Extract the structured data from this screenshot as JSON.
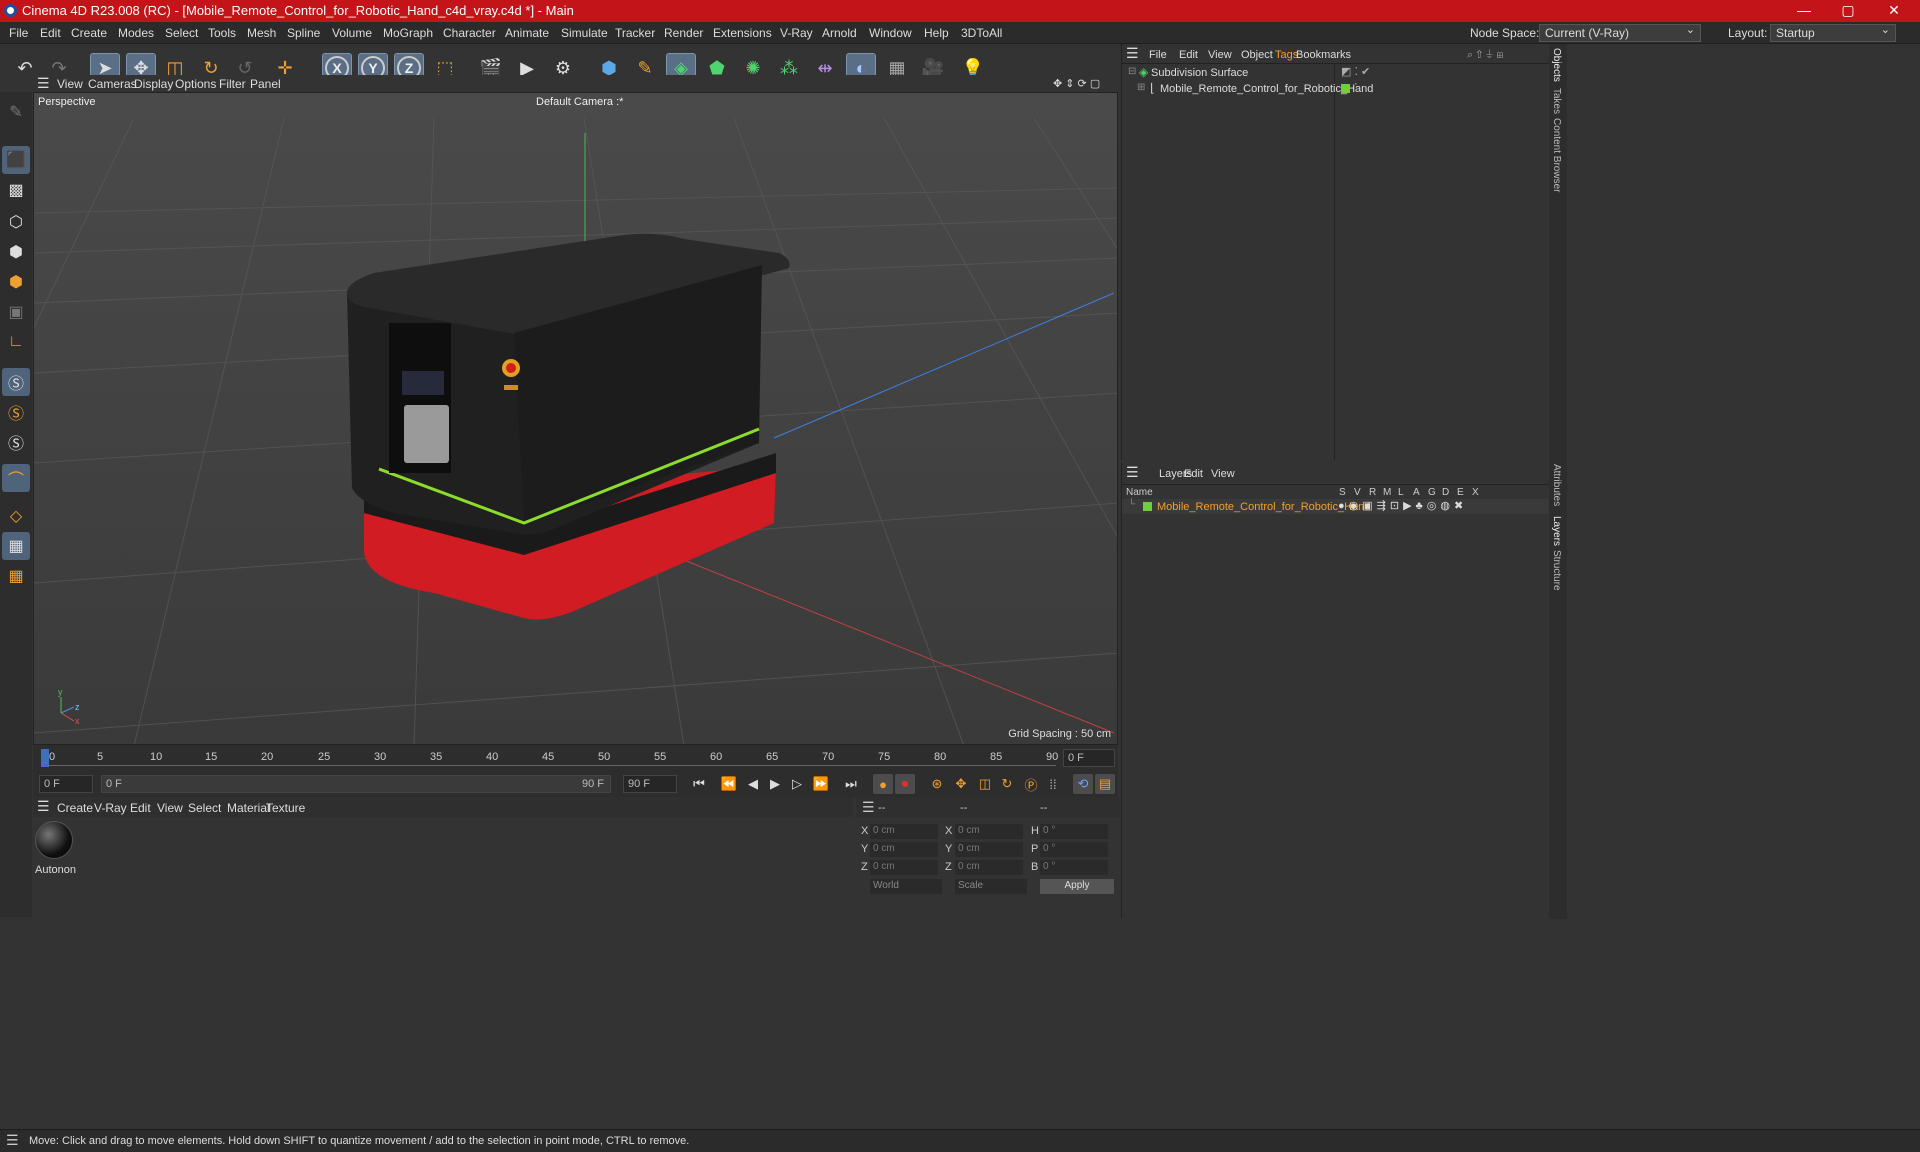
{
  "window": {
    "title": "Cinema 4D R23.008 (RC) - [Mobile_Remote_Control_for_Robotic_Hand_c4d_vray.c4d *] - Main",
    "min": "—",
    "max": "▢",
    "close": "✕"
  },
  "menu": [
    "File",
    "Edit",
    "Create",
    "Modes",
    "Select",
    "Tools",
    "Mesh",
    "Spline",
    "Volume",
    "MoGraph",
    "Character",
    "Animate",
    "Simulate",
    "Tracker",
    "Render",
    "Extensions",
    "V-Ray",
    "Arnold",
    "Window",
    "Help",
    "3DToAll"
  ],
  "node_space": {
    "label": "Node Space:",
    "value": "Current (V-Ray)"
  },
  "layout": {
    "label": "Layout:",
    "value": "Startup"
  },
  "viewport": {
    "menu": [
      "View",
      "Cameras",
      "Display",
      "Options",
      "Filter",
      "Panel"
    ],
    "label": "Perspective",
    "camera": "Default Camera :*",
    "grid_spacing": "Grid Spacing : 50 cm"
  },
  "timeline": {
    "ticks": [
      "0",
      "5",
      "10",
      "15",
      "20",
      "25",
      "30",
      "35",
      "40",
      "45",
      "50",
      "55",
      "60",
      "65",
      "70",
      "75",
      "80",
      "85",
      "90"
    ],
    "current": "0 F"
  },
  "transport": {
    "start": "0 F",
    "range_start": "0 F",
    "range_end": "90 F",
    "end": "90 F"
  },
  "material": {
    "menu": [
      "Create",
      "V-Ray",
      "Edit",
      "View",
      "Select",
      "Material",
      "Texture"
    ],
    "items": [
      {
        "name": "Autonon"
      }
    ]
  },
  "coords": {
    "headers": [
      "--",
      "--",
      "--"
    ],
    "rows": [
      {
        "a": "X",
        "av": "0 cm",
        "b": "X",
        "bv": "0 cm",
        "c": "H",
        "cv": "0 °"
      },
      {
        "a": "Y",
        "av": "0 cm",
        "b": "Y",
        "bv": "0 cm",
        "c": "P",
        "cv": "0 °"
      },
      {
        "a": "Z",
        "av": "0 cm",
        "b": "Z",
        "bv": "0 cm",
        "c": "B",
        "cv": "0 °"
      }
    ],
    "mode1": "World",
    "mode2": "Scale",
    "apply": "Apply"
  },
  "objects": {
    "menu": [
      "File",
      "Edit",
      "View",
      "Object",
      "Tags",
      "Bookmarks"
    ],
    "items": [
      {
        "name": "Subdivision Surface"
      },
      {
        "name": "Mobile_Remote_Control_for_Robotic_Hand"
      }
    ]
  },
  "layers": {
    "menu": [
      "Layers",
      "Edit",
      "View"
    ],
    "col_name": "Name",
    "cols": [
      "S",
      "V",
      "R",
      "M",
      "L",
      "A",
      "G",
      "D",
      "E",
      "X"
    ],
    "items": [
      {
        "name": "Mobile_Remote_Control_for_Robotic_Hand"
      }
    ]
  },
  "side_tabs": [
    "Objects",
    "Takes",
    "Content Browser",
    "Attributes",
    "Layers",
    "Structure"
  ],
  "status": "Move: Click and drag to move elements. Hold down SHIFT to quantize movement / add to the selection in point mode, CTRL to remove.",
  "colors": {
    "title_bar": "#c3141a",
    "accent": "#f0a030",
    "layer_green": "#6fcf3a"
  }
}
